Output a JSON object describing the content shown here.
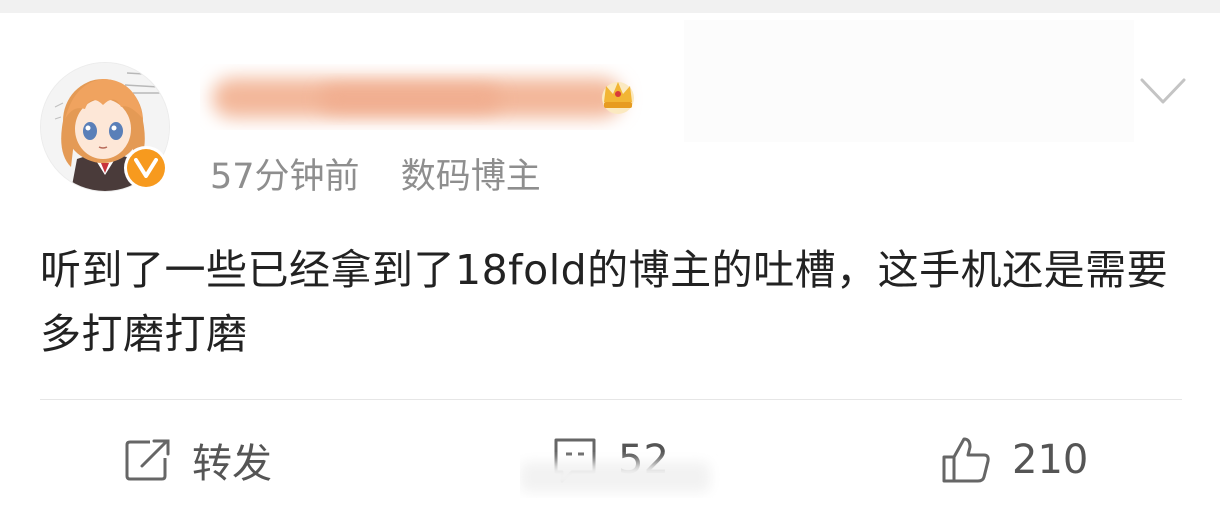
{
  "post": {
    "time": "57分钟前",
    "source_tag": "数码博主",
    "text": "听到了一些已经拿到了18fold的博主的吐槽，这手机还是需要多打磨打磨"
  },
  "actions": {
    "repost_label": "转发",
    "comment_count": "52",
    "like_count": "210"
  },
  "icons": {
    "menu": "chevron-down-icon",
    "verified": "verified-v-icon",
    "member": "crown-icon",
    "repost": "share-icon",
    "comment": "comment-icon",
    "like": "thumbs-up-icon"
  },
  "colors": {
    "meta_text": "#8e8e8e",
    "post_text": "#222222",
    "action_text": "#555555",
    "verified_badge": "#f79a1e"
  }
}
